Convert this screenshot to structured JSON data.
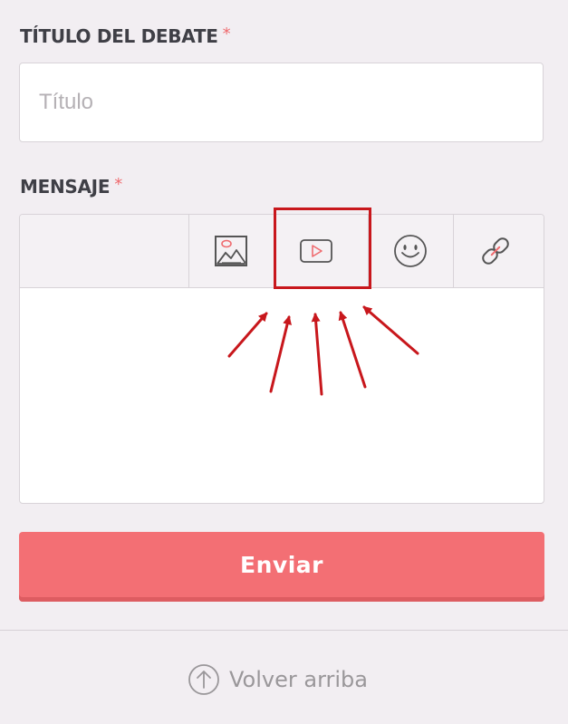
{
  "form": {
    "title_label": "TÍTULO DEL DEBATE",
    "required_mark": "*",
    "title_placeholder": "Título",
    "title_value": "",
    "message_label": "MENSAJE",
    "message_value": "",
    "toolbar": [
      {
        "icon": "image-icon"
      },
      {
        "icon": "video-play-icon"
      },
      {
        "icon": "smiley-icon"
      },
      {
        "icon": "link-icon"
      }
    ],
    "submit_label": "Enviar"
  },
  "footer": {
    "back_to_top_label": "Volver arriba",
    "back_to_top_icon": "arrow-up-circle-icon"
  },
  "colors": {
    "accent": "#f36f74",
    "required": "#ef6b6f",
    "annotation": "#c8171c",
    "background": "#f2eef2"
  }
}
